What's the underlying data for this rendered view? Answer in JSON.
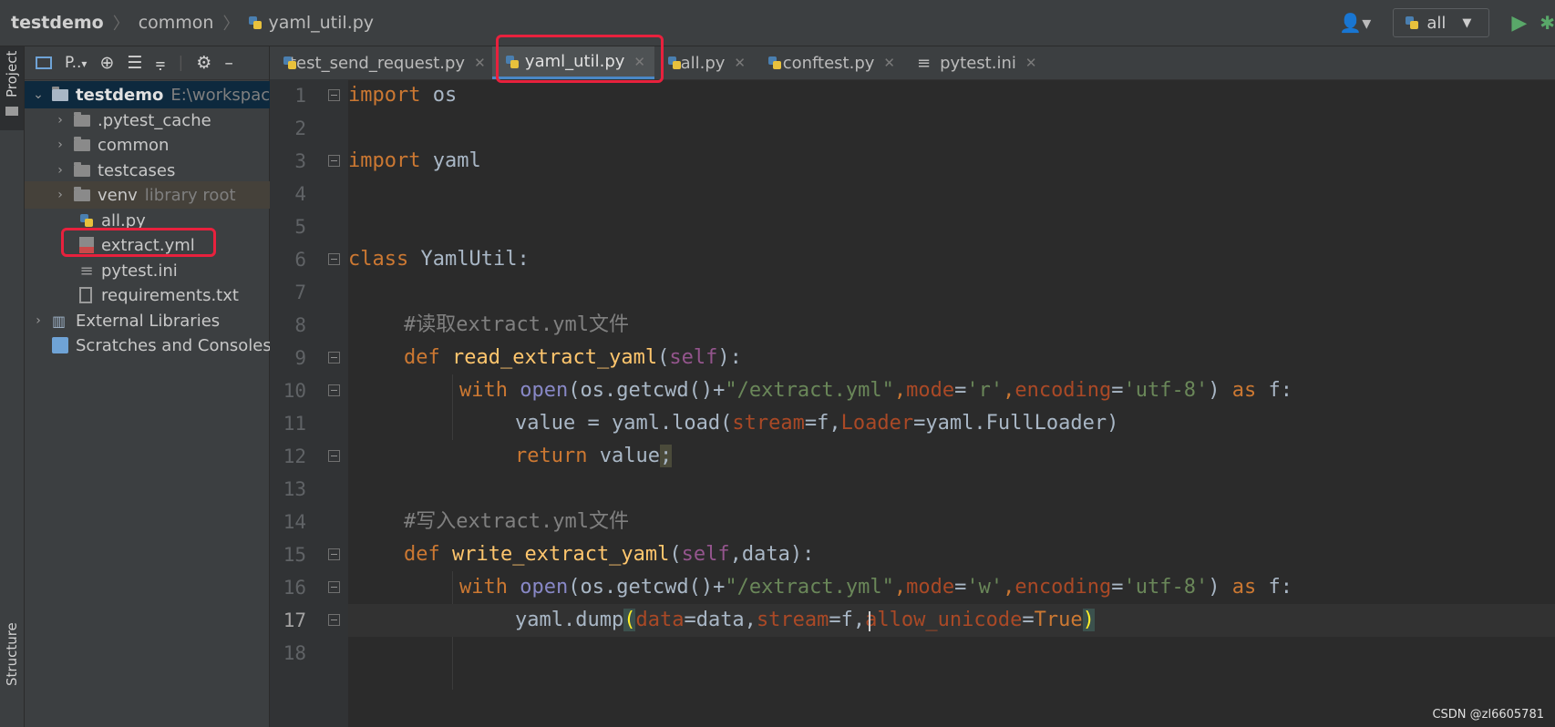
{
  "breadcrumb": {
    "project": "testdemo",
    "folder": "common",
    "file": "yaml_util.py"
  },
  "run_config": {
    "label": "all"
  },
  "side_tabs": {
    "project": "Project",
    "structure": "Structure"
  },
  "project_panel": {
    "view_label": "P..",
    "tree": [
      {
        "label": "testdemo",
        "hint": "E:\\workspac",
        "type": "root"
      },
      {
        "label": ".pytest_cache",
        "hint": "",
        "type": "folder"
      },
      {
        "label": "common",
        "hint": "",
        "type": "folder"
      },
      {
        "label": "testcases",
        "hint": "",
        "type": "folder"
      },
      {
        "label": "venv",
        "hint": "library root",
        "type": "folder"
      },
      {
        "label": "all.py",
        "hint": "",
        "type": "file"
      },
      {
        "label": "extract.yml",
        "hint": "",
        "type": "file"
      },
      {
        "label": "pytest.ini",
        "hint": "",
        "type": "file"
      },
      {
        "label": "requirements.txt",
        "hint": "",
        "type": "file"
      },
      {
        "label": "External Libraries",
        "hint": "",
        "type": "lib"
      },
      {
        "label": "Scratches and Consoles",
        "hint": "",
        "type": "scratch"
      }
    ]
  },
  "tabs": [
    {
      "label": "test_send_request.py"
    },
    {
      "label": "yaml_util.py"
    },
    {
      "label": "all.py"
    },
    {
      "label": "conftest.py"
    },
    {
      "label": "pytest.ini"
    }
  ],
  "line_numbers": [
    "1",
    "2",
    "3",
    "4",
    "5",
    "6",
    "7",
    "8",
    "9",
    "10",
    "11",
    "12",
    "13",
    "14",
    "15",
    "16",
    "17",
    "18"
  ],
  "code": {
    "l1": [
      "import",
      " os"
    ],
    "l3": [
      "import",
      " yaml"
    ],
    "l6": [
      "class",
      " YamlUtil:"
    ],
    "l8": [
      "#读取extract.yml文件"
    ],
    "l9": [
      "def",
      " ",
      "read_extract_yaml",
      "(",
      "self",
      "):"
    ],
    "l10": [
      "with",
      " ",
      "open",
      "(os.getcwd()+",
      "\"/extract.yml\"",
      ",",
      "mode",
      "=",
      "'r'",
      ",",
      "encoding",
      "=",
      "'utf-8'",
      ") ",
      "as",
      " f:"
    ],
    "l11": [
      "value = yaml.load(",
      "stream",
      "=f,",
      "Loader",
      "=yaml.FullLoader)"
    ],
    "l12": [
      "return",
      " value",
      ";"
    ],
    "l14": [
      "#写入extract.yml文件"
    ],
    "l15": [
      "def",
      " ",
      "write_extract_yaml",
      "(",
      "self",
      ",data):"
    ],
    "l16": [
      "with",
      " ",
      "open",
      "(os.getcwd()+",
      "\"/extract.yml\"",
      ",",
      "mode",
      "=",
      "'w'",
      ",",
      "encoding",
      "=",
      "'utf-8'",
      ") ",
      "as",
      " f:"
    ],
    "l17": [
      "yaml.dump",
      "(",
      "data",
      "=data,",
      "stream",
      "=f,",
      "allow_unicode",
      "=",
      "True",
      ")"
    ]
  },
  "watermark": "CSDN @zl6605781",
  "colors": {
    "highlight_box": "#e8213d",
    "keyword": "#cc7832",
    "function": "#ffc66d",
    "string": "#6a8759",
    "param": "#aa4926"
  }
}
